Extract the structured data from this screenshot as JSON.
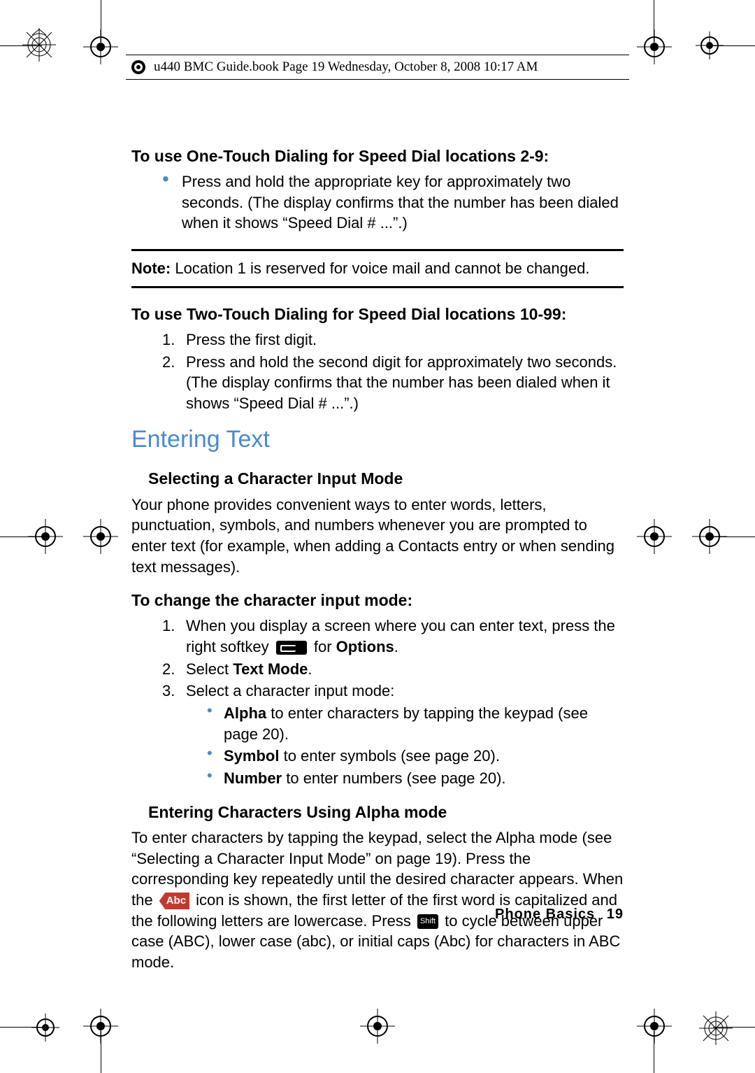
{
  "header": {
    "running_head": "u440 BMC Guide.book  Page 19  Wednesday, October 8, 2008  10:17 AM"
  },
  "sections": {
    "oneTouch": {
      "title": "To use One-Touch Dialing for Speed Dial locations 2-9:",
      "bullet": "Press and hold the appropriate key for approximately two seconds. (The display confirms that the number has been dialed when it shows “Speed Dial # ...”.)"
    },
    "note": {
      "label": "Note:",
      "text": " Location 1 is reserved for voice mail and cannot be changed."
    },
    "twoTouch": {
      "title": "To use Two-Touch Dialing for Speed Dial locations 10-99:",
      "steps": [
        "Press the first digit.",
        "Press and hold the second digit for approximately two seconds. (The display confirms that the number has been dialed when it shows “Speed Dial # ...”.)"
      ]
    },
    "entering": {
      "h2": "Entering Text",
      "selecting": {
        "title": "Selecting a Character Input Mode",
        "para": "Your phone provides convenient ways to enter words, letters, punctuation, symbols, and numbers whenever you are prompted to enter text (for example, when adding a Contacts entry or when sending text messages)."
      },
      "change": {
        "title": "To change the character input mode:",
        "step1_a": "When you display a screen where you can enter text, press the right softkey ",
        "step1_b": " for ",
        "step1_c": "Options",
        "step1_d": ".",
        "step2_a": "Select ",
        "step2_b": "Text Mode",
        "step2_c": ".",
        "step3": "Select a character input mode:",
        "modes": {
          "alpha_b": "Alpha",
          "alpha_t": " to enter characters by tapping the keypad (see page 20).",
          "symbol_b": "Symbol",
          "symbol_t": " to enter symbols (see page 20).",
          "number_b": "Number",
          "number_t": " to enter numbers (see page 20)."
        }
      },
      "alphaMode": {
        "title": "Entering Characters Using Alpha mode",
        "p1": "To enter characters by tapping the keypad, select the Alpha mode (see “Selecting a Character Input Mode” on page 19). Press the corresponding key repeatedly until the desired character appears. When the ",
        "abc": "Abc",
        "p2": " icon is shown, the first letter of the first word is capitalized and the following letters are lowercase. Press ",
        "shift": "Shift",
        "p3": " to cycle between upper case (ABC), lower case (abc), or initial caps (Abc) for characters in ABC mode."
      }
    }
  },
  "footer": {
    "section": "Phone Basics",
    "page": "19"
  }
}
